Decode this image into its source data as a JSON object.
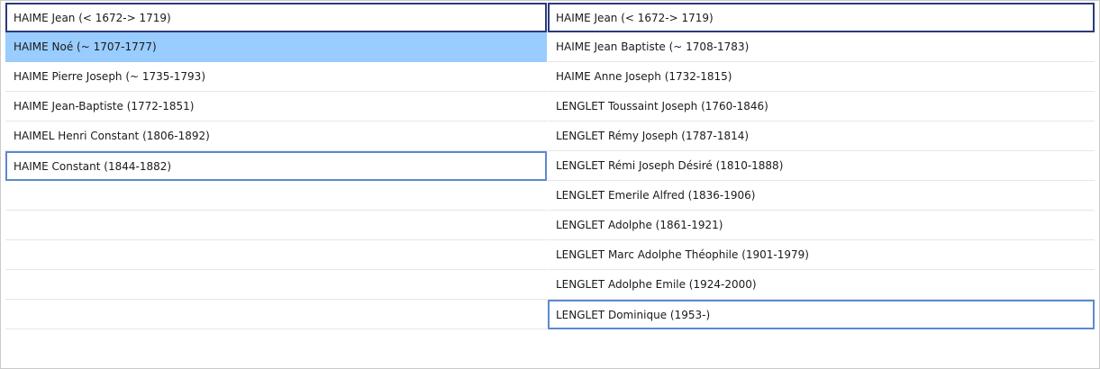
{
  "left_lineage": [
    {
      "label": "HAIME Jean (< 1672-> 1719)",
      "state": "focus-start"
    },
    {
      "label": "HAIME Noé (~ 1707-1777)",
      "state": "selected"
    },
    {
      "label": "HAIME Pierre Joseph (~ 1735-1793)",
      "state": "normal"
    },
    {
      "label": "HAIME Jean-Baptiste (1772-1851)",
      "state": "normal"
    },
    {
      "label": "HAIMEL Henri Constant (1806-1892)",
      "state": "normal"
    },
    {
      "label": "HAIME Constant (1844-1882)",
      "state": "focus-end"
    }
  ],
  "left_empty_rows": 5,
  "right_lineage": [
    {
      "label": "HAIME Jean (< 1672-> 1719)",
      "state": "focus-start"
    },
    {
      "label": "HAIME Jean Baptiste (~ 1708-1783)",
      "state": "normal"
    },
    {
      "label": "HAIME Anne Joseph (1732-1815)",
      "state": "normal"
    },
    {
      "label": "LENGLET Toussaint Joseph (1760-1846)",
      "state": "normal"
    },
    {
      "label": "LENGLET Rémy Joseph (1787-1814)",
      "state": "normal"
    },
    {
      "label": "LENGLET Rémi Joseph Désiré (1810-1888)",
      "state": "normal"
    },
    {
      "label": "LENGLET Emerile Alfred (1836-1906)",
      "state": "normal"
    },
    {
      "label": "LENGLET Adolphe (1861-1921)",
      "state": "normal"
    },
    {
      "label": "LENGLET Marc Adolphe Théophile (1901-1979)",
      "state": "normal"
    },
    {
      "label": "LENGLET Adolphe Emile (1924-2000)",
      "state": "normal"
    },
    {
      "label": "LENGLET Dominique (1953-)",
      "state": "focus-end"
    }
  ],
  "right_empty_rows": 0
}
